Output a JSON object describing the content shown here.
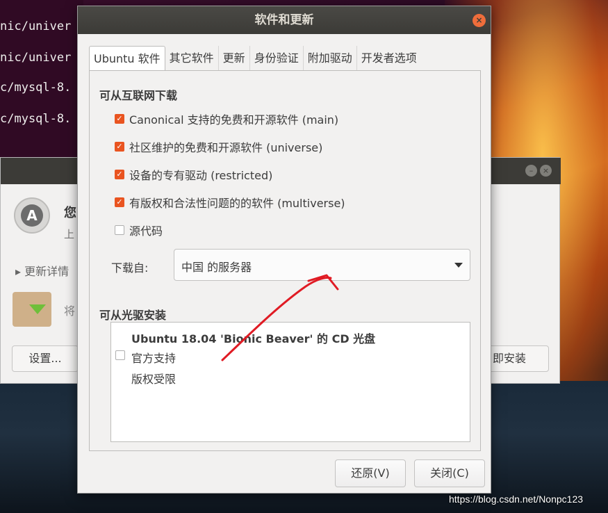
{
  "terminal": {
    "lines": [
      "nic/univer",
      "nic/univer",
      "c/mysql-8.",
      "c/mysql-8."
    ]
  },
  "background_window": {
    "heading_partial": "您",
    "subtext_partial": "上",
    "details_partial": "▸ 更新详情",
    "package_partial": "将",
    "settings_button": "设置...",
    "install_button_partial": "即安装",
    "updater_icon": "software-updater-icon",
    "package_icon": "package-download-icon"
  },
  "dialog": {
    "title": "软件和更新",
    "close_icon": "close-icon",
    "tabs": [
      "Ubuntu 软件",
      "其它软件",
      "更新",
      "身份验证",
      "附加驱动",
      "开发者选项"
    ],
    "active_tab": 0,
    "internet_section": {
      "heading": "可从互联网下载",
      "options": [
        {
          "label": "Canonical 支持的免费和开源软件 (main)",
          "checked": true
        },
        {
          "label": "社区维护的免费和开源软件 (universe)",
          "checked": true
        },
        {
          "label": "设备的专有驱动 (restricted)",
          "checked": true
        },
        {
          "label": "有版权和合法性问题的的软件 (multiverse)",
          "checked": true
        },
        {
          "label": "源代码",
          "checked": false
        }
      ],
      "download_from_label": "下载自:",
      "download_from_value": "中国 的服务器"
    },
    "cdrom_section": {
      "heading": "可从光驱安装",
      "cd_title": "Ubuntu 18.04 'Bionic Beaver' 的 CD 光盘",
      "cd_line1": "官方支持",
      "cd_line2": "版权受限",
      "cd_checked": false
    },
    "buttons": {
      "revert": "还原(V)",
      "close": "关闭(C)"
    }
  },
  "annotation_color": "#e01b24",
  "watermark": "https://blog.csdn.net/Nonpc123",
  "colors": {
    "accent": "#e95420",
    "titlebar": "#3c3b37",
    "window_bg": "#f2f1f0"
  }
}
